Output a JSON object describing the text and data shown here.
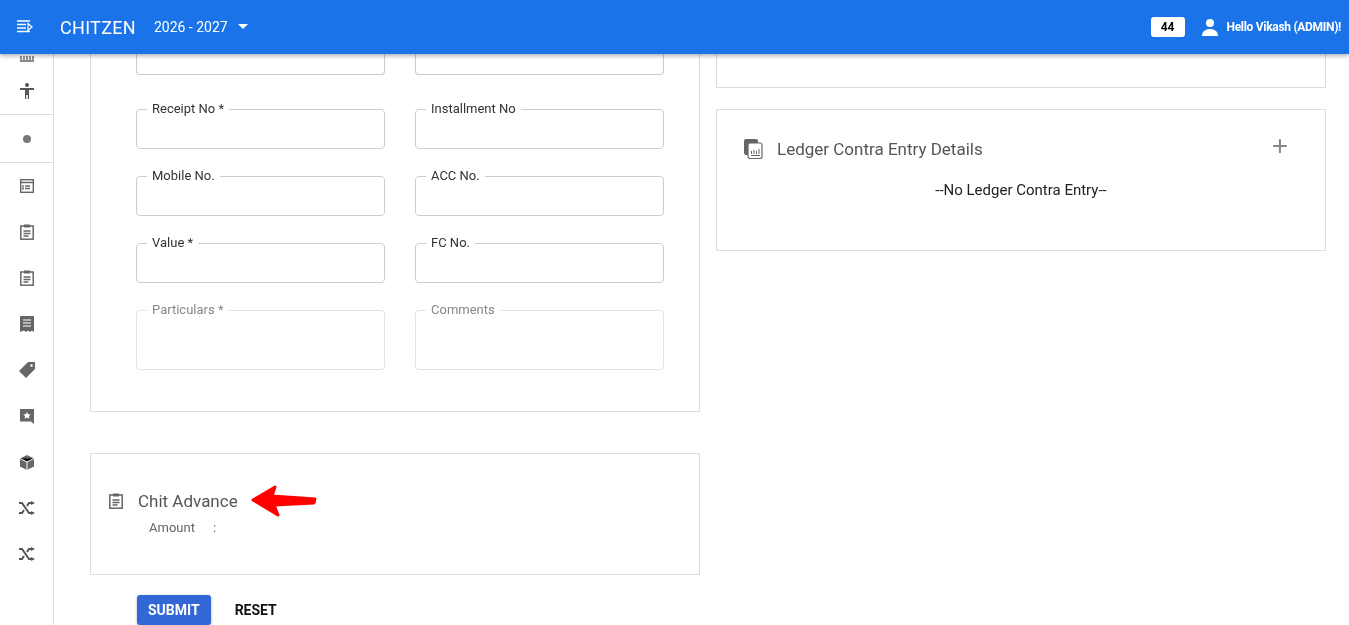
{
  "header": {
    "brand": "CHITZEN",
    "year": "2026 - 2027",
    "badge": "44",
    "greeting": "Hello Vikash (ADMIN)!"
  },
  "form": {
    "fields": [
      {
        "label": "Receipt No *",
        "disabled": false,
        "multiline": false
      },
      {
        "label": "Installment No",
        "disabled": false,
        "multiline": false
      },
      {
        "label": "Mobile No.",
        "disabled": false,
        "multiline": false
      },
      {
        "label": "ACC No.",
        "disabled": false,
        "multiline": false
      },
      {
        "label": "Value *",
        "disabled": false,
        "multiline": false
      },
      {
        "label": "FC No.",
        "disabled": false,
        "multiline": false
      },
      {
        "label": "Particulars *",
        "disabled": true,
        "multiline": true
      },
      {
        "label": "Comments",
        "disabled": true,
        "multiline": true
      }
    ]
  },
  "chit_advance": {
    "title": "Chit Advance",
    "amount_label": "Amount",
    "separator": ":"
  },
  "buttons": {
    "submit": "SUBMIT",
    "reset": "RESET"
  },
  "ledger": {
    "title": "Ledger Contra Entry Details",
    "add": "+",
    "empty": "--No Ledger Contra Entry--"
  }
}
